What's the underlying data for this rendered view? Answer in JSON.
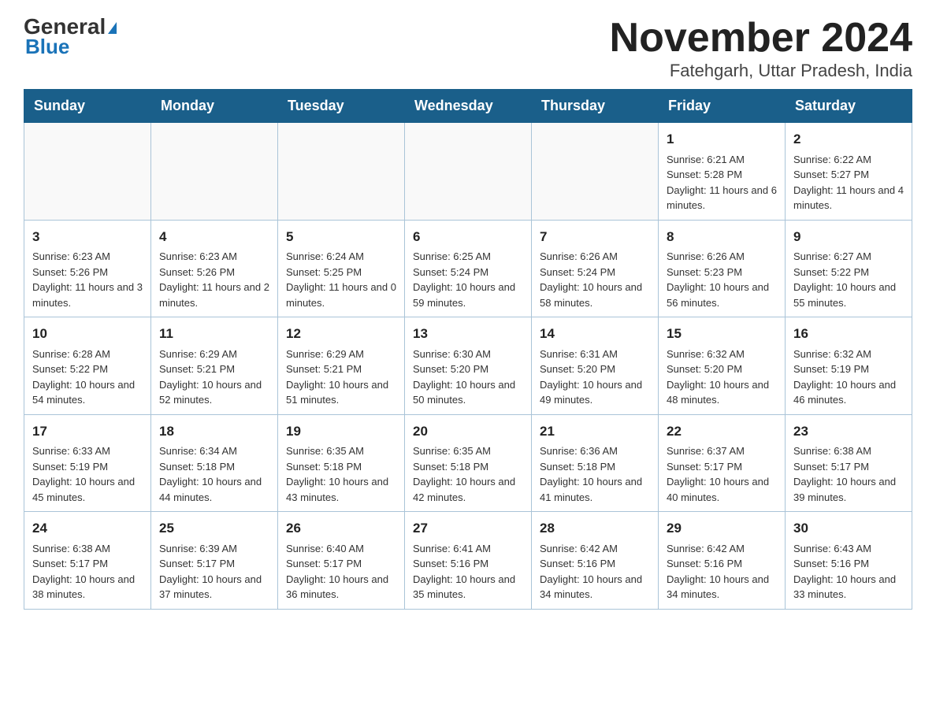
{
  "logo": {
    "general": "General",
    "blue": "Blue",
    "triangle": "▶"
  },
  "title": "November 2024",
  "subtitle": "Fatehgarh, Uttar Pradesh, India",
  "days_of_week": [
    "Sunday",
    "Monday",
    "Tuesday",
    "Wednesday",
    "Thursday",
    "Friday",
    "Saturday"
  ],
  "weeks": [
    [
      {
        "day": "",
        "info": ""
      },
      {
        "day": "",
        "info": ""
      },
      {
        "day": "",
        "info": ""
      },
      {
        "day": "",
        "info": ""
      },
      {
        "day": "",
        "info": ""
      },
      {
        "day": "1",
        "info": "Sunrise: 6:21 AM\nSunset: 5:28 PM\nDaylight: 11 hours and 6 minutes."
      },
      {
        "day": "2",
        "info": "Sunrise: 6:22 AM\nSunset: 5:27 PM\nDaylight: 11 hours and 4 minutes."
      }
    ],
    [
      {
        "day": "3",
        "info": "Sunrise: 6:23 AM\nSunset: 5:26 PM\nDaylight: 11 hours and 3 minutes."
      },
      {
        "day": "4",
        "info": "Sunrise: 6:23 AM\nSunset: 5:26 PM\nDaylight: 11 hours and 2 minutes."
      },
      {
        "day": "5",
        "info": "Sunrise: 6:24 AM\nSunset: 5:25 PM\nDaylight: 11 hours and 0 minutes."
      },
      {
        "day": "6",
        "info": "Sunrise: 6:25 AM\nSunset: 5:24 PM\nDaylight: 10 hours and 59 minutes."
      },
      {
        "day": "7",
        "info": "Sunrise: 6:26 AM\nSunset: 5:24 PM\nDaylight: 10 hours and 58 minutes."
      },
      {
        "day": "8",
        "info": "Sunrise: 6:26 AM\nSunset: 5:23 PM\nDaylight: 10 hours and 56 minutes."
      },
      {
        "day": "9",
        "info": "Sunrise: 6:27 AM\nSunset: 5:22 PM\nDaylight: 10 hours and 55 minutes."
      }
    ],
    [
      {
        "day": "10",
        "info": "Sunrise: 6:28 AM\nSunset: 5:22 PM\nDaylight: 10 hours and 54 minutes."
      },
      {
        "day": "11",
        "info": "Sunrise: 6:29 AM\nSunset: 5:21 PM\nDaylight: 10 hours and 52 minutes."
      },
      {
        "day": "12",
        "info": "Sunrise: 6:29 AM\nSunset: 5:21 PM\nDaylight: 10 hours and 51 minutes."
      },
      {
        "day": "13",
        "info": "Sunrise: 6:30 AM\nSunset: 5:20 PM\nDaylight: 10 hours and 50 minutes."
      },
      {
        "day": "14",
        "info": "Sunrise: 6:31 AM\nSunset: 5:20 PM\nDaylight: 10 hours and 49 minutes."
      },
      {
        "day": "15",
        "info": "Sunrise: 6:32 AM\nSunset: 5:20 PM\nDaylight: 10 hours and 48 minutes."
      },
      {
        "day": "16",
        "info": "Sunrise: 6:32 AM\nSunset: 5:19 PM\nDaylight: 10 hours and 46 minutes."
      }
    ],
    [
      {
        "day": "17",
        "info": "Sunrise: 6:33 AM\nSunset: 5:19 PM\nDaylight: 10 hours and 45 minutes."
      },
      {
        "day": "18",
        "info": "Sunrise: 6:34 AM\nSunset: 5:18 PM\nDaylight: 10 hours and 44 minutes."
      },
      {
        "day": "19",
        "info": "Sunrise: 6:35 AM\nSunset: 5:18 PM\nDaylight: 10 hours and 43 minutes."
      },
      {
        "day": "20",
        "info": "Sunrise: 6:35 AM\nSunset: 5:18 PM\nDaylight: 10 hours and 42 minutes."
      },
      {
        "day": "21",
        "info": "Sunrise: 6:36 AM\nSunset: 5:18 PM\nDaylight: 10 hours and 41 minutes."
      },
      {
        "day": "22",
        "info": "Sunrise: 6:37 AM\nSunset: 5:17 PM\nDaylight: 10 hours and 40 minutes."
      },
      {
        "day": "23",
        "info": "Sunrise: 6:38 AM\nSunset: 5:17 PM\nDaylight: 10 hours and 39 minutes."
      }
    ],
    [
      {
        "day": "24",
        "info": "Sunrise: 6:38 AM\nSunset: 5:17 PM\nDaylight: 10 hours and 38 minutes."
      },
      {
        "day": "25",
        "info": "Sunrise: 6:39 AM\nSunset: 5:17 PM\nDaylight: 10 hours and 37 minutes."
      },
      {
        "day": "26",
        "info": "Sunrise: 6:40 AM\nSunset: 5:17 PM\nDaylight: 10 hours and 36 minutes."
      },
      {
        "day": "27",
        "info": "Sunrise: 6:41 AM\nSunset: 5:16 PM\nDaylight: 10 hours and 35 minutes."
      },
      {
        "day": "28",
        "info": "Sunrise: 6:42 AM\nSunset: 5:16 PM\nDaylight: 10 hours and 34 minutes."
      },
      {
        "day": "29",
        "info": "Sunrise: 6:42 AM\nSunset: 5:16 PM\nDaylight: 10 hours and 34 minutes."
      },
      {
        "day": "30",
        "info": "Sunrise: 6:43 AM\nSunset: 5:16 PM\nDaylight: 10 hours and 33 minutes."
      }
    ]
  ]
}
